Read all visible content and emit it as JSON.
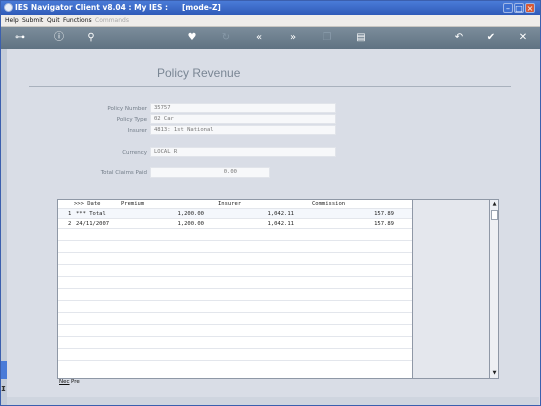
{
  "window": {
    "title": "IES Navigator Client v8.04 : My IES :",
    "mode": "[mode-Z]"
  },
  "menu": {
    "items": [
      "Help",
      "Submit",
      "Quit",
      "Functions"
    ],
    "disabled_item": "Commands"
  },
  "form": {
    "title": "Policy Revenue",
    "policy_number_label": "Policy Number",
    "policy_number_value": "35757",
    "policy_type_label": "Policy Type",
    "policy_type_value": "02 Car",
    "insurer_label": "Insurer",
    "insurer_value": "4813: 1st National",
    "currency_label": "Currency",
    "currency_value": "LOCAL R",
    "total_claims_label": "Total Claims Paid",
    "total_claims_value": "0.00"
  },
  "grid": {
    "columns": [
      ">>> Date",
      "Premium",
      "Insurer",
      "Commission"
    ],
    "rows": [
      {
        "idx": "1",
        "date": "*** Total",
        "premium": "1,200.00",
        "insurer": "1,042.11",
        "commission": "157.89"
      },
      {
        "idx": "2",
        "date": "24/11/2007",
        "premium": "1,200.00",
        "insurer": "1,042.11",
        "commission": "157.89"
      }
    ],
    "footer_nec": "Nec",
    "footer_pre": "Pre"
  },
  "icons": [
    "key-icon",
    "info-icon",
    "search-icon",
    "heart-icon",
    "refresh-icon",
    "rewind-icon",
    "forward-icon",
    "copy-icon",
    "document-icon",
    "back-icon",
    "check-icon",
    "close-icon"
  ],
  "colors": {
    "titlebar": "#3768c6",
    "toolbar": "#6e808f",
    "background": "#d9dde6",
    "close_button": "#d65a36"
  }
}
